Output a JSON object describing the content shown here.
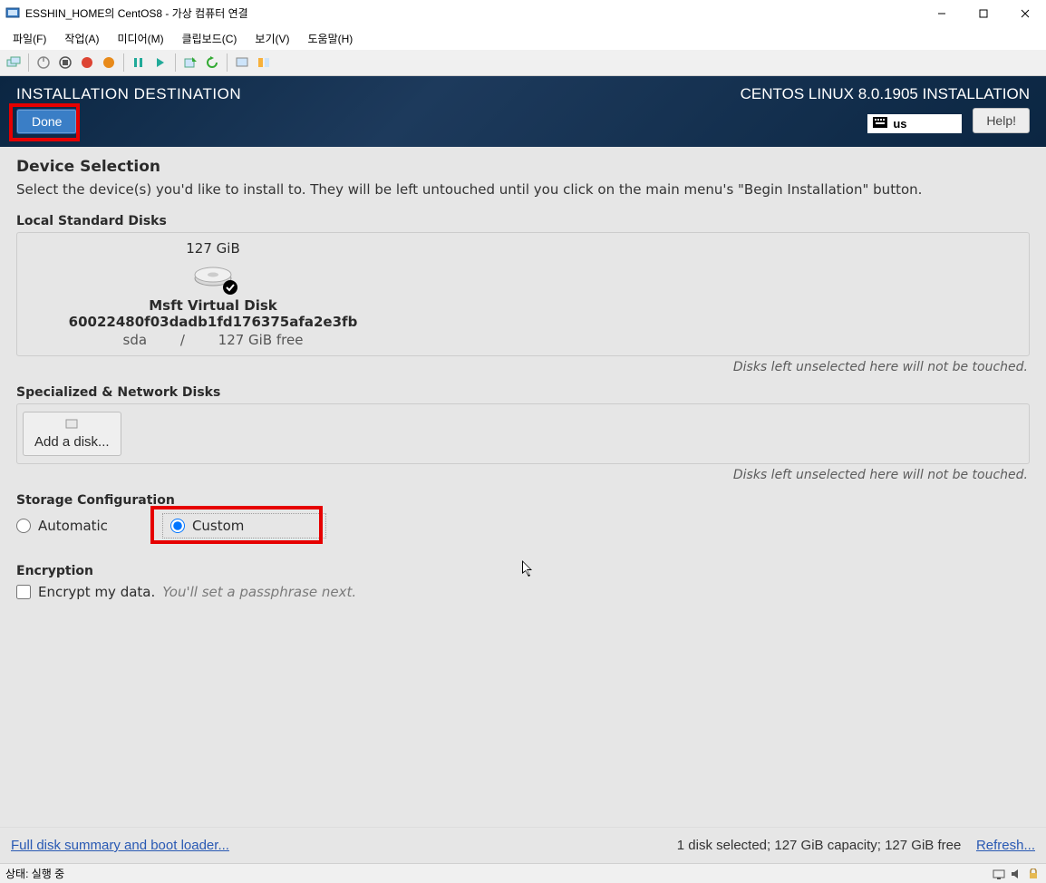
{
  "window": {
    "title": "ESSHIN_HOME의 CentOS8 - 가상 컴퓨터 연결"
  },
  "menu": {
    "file": "파일(F)",
    "action": "작업(A)",
    "media": "미디어(M)",
    "clipboard": "클립보드(C)",
    "view": "보기(V)",
    "help": "도움말(H)"
  },
  "header": {
    "page_title": "INSTALLATION DESTINATION",
    "done": "Done",
    "install_title": "CENTOS LINUX 8.0.1905 INSTALLATION",
    "keyboard": "us",
    "help": "Help!"
  },
  "device_selection": {
    "title": "Device Selection",
    "subtitle": "Select the device(s) you'd like to install to.  They will be left untouched until you click on the main menu's \"Begin Installation\" button."
  },
  "local_disks": {
    "label": "Local Standard Disks",
    "disk": {
      "size": "127 GiB",
      "name": "Msft Virtual Disk 60022480f03dadb1fd176375afa2e3fb",
      "dev": "sda",
      "sep": "/",
      "free": "127 GiB free"
    },
    "hint": "Disks left unselected here will not be touched."
  },
  "network_disks": {
    "label": "Specialized & Network Disks",
    "add": "Add a disk...",
    "hint": "Disks left unselected here will not be touched."
  },
  "storage": {
    "label": "Storage Configuration",
    "automatic": "Automatic",
    "custom": "Custom"
  },
  "encryption": {
    "label": "Encryption",
    "check": "Encrypt my data.",
    "hint": "You'll set a passphrase next."
  },
  "footer": {
    "full_summary": "Full disk summary and boot loader...",
    "status": "1 disk selected; 127 GiB capacity; 127 GiB free",
    "refresh": "Refresh..."
  },
  "statusbar": {
    "text": "상태: 실행 중"
  }
}
